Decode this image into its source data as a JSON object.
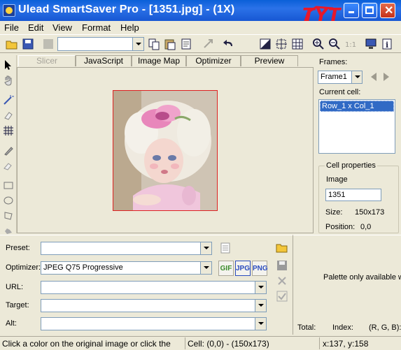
{
  "window": {
    "title": "Ulead SmartSaver Pro - [1351.jpg] - (1X)"
  },
  "annotation": {
    "scribble_text": "TYT",
    "color": "#e8182a"
  },
  "menu": {
    "items": [
      "File",
      "Edit",
      "View",
      "Format",
      "Help"
    ]
  },
  "tabs": [
    {
      "label": "Slicer",
      "selected": true
    },
    {
      "label": "JavaScript",
      "selected": false
    },
    {
      "label": "Image Map",
      "selected": false
    },
    {
      "label": "Optimizer",
      "selected": false
    },
    {
      "label": "Preview",
      "selected": false
    }
  ],
  "frames": {
    "label": "Frames:",
    "value": "Frame1"
  },
  "current_cell": {
    "label": "Current cell:",
    "items": [
      "Row_1 x Col_1"
    ]
  },
  "cell_properties": {
    "legend": "Cell properties",
    "image_label": "Image",
    "image_value": "1351",
    "size_label": "Size:",
    "size_value": "150x173",
    "position_label": "Position:",
    "position_value": "0,0"
  },
  "bottom": {
    "preset_label": "Preset:",
    "preset_value": "",
    "optimizer_label": "Optimizer:",
    "optimizer_value": "JPEG Q75 Progressive",
    "url_label": "URL:",
    "url_value": "",
    "target_label": "Target:",
    "target_value": "",
    "alt_label": "Alt:",
    "alt_value": "",
    "formats": [
      "GIF",
      "JPG",
      "PNG"
    ]
  },
  "palette": {
    "message": "Palette only available w",
    "total_label": "Total:",
    "index_label": "Index:",
    "rgb_label": "(R, G, B):"
  },
  "status": {
    "hint": "Click a color on the original image or click the",
    "cell_info": "Cell: (0,0) - (150x173)",
    "coords": "x:137, y:158"
  },
  "icons": {
    "title_app": "ulead-app-icon",
    "open": "open-folder-icon",
    "save": "save-icon"
  }
}
